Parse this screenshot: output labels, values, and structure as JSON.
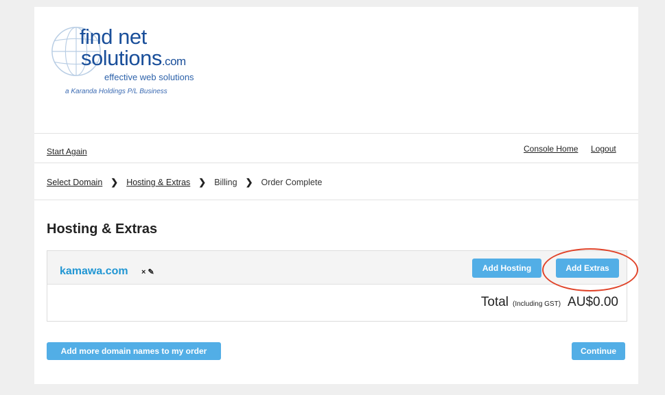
{
  "logo": {
    "line1": "find net",
    "line2": "solutions",
    "line2_suffix": ".com",
    "tagline": "effective web solutions",
    "business": "a Karanda Holdings P/L Business"
  },
  "nav": {
    "start_again": "Start Again",
    "console_home": "Console Home",
    "logout": "Logout"
  },
  "breadcrumb": [
    {
      "label": "Select Domain",
      "link": true
    },
    {
      "label": "Hosting & Extras",
      "link": true
    },
    {
      "label": "Billing",
      "link": false
    },
    {
      "label": "Order Complete",
      "link": false
    }
  ],
  "page_title": "Hosting & Extras",
  "order": {
    "domain": "kamawa.com",
    "action_icons": "× ✎",
    "add_hosting": "Add Hosting",
    "add_extras": "Add Extras",
    "total_label": "Total",
    "total_sub": "(Including GST)",
    "total_amount": "AU$0.00"
  },
  "footer": {
    "add_more": "Add more domain names to my order",
    "continue": "Continue"
  },
  "colors": {
    "accent": "#52aee6",
    "domain": "#2196d3",
    "highlight": "#e0442a",
    "logo": "#1a4f9a"
  }
}
